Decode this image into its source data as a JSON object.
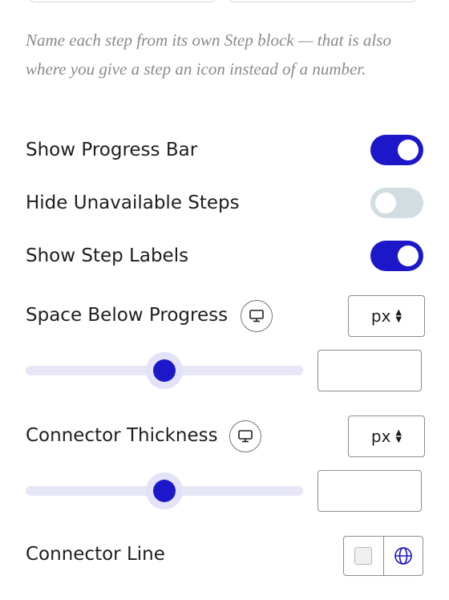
{
  "help_text": "Name each step from its own Step block — that is also where you give a step an icon instead of a number.",
  "toggles": {
    "show_progress_bar": {
      "label": "Show Progress Bar",
      "checked": true
    },
    "hide_unavailable_steps": {
      "label": "Hide Unavailable Steps",
      "checked": false
    },
    "show_step_labels": {
      "label": "Show Step Labels",
      "checked": true
    }
  },
  "space_below_progress": {
    "label": "Space Below Progress",
    "device_icon": "desktop-icon",
    "unit": "px",
    "slider_fraction": 0.5,
    "value": ""
  },
  "connector_thickness": {
    "label": "Connector Thickness",
    "device_icon": "desktop-icon",
    "unit": "px",
    "slider_fraction": 0.5,
    "value": ""
  },
  "connector_line": {
    "label": "Connector Line",
    "color_icon": "color-swatch-icon",
    "global_icon": "globe-icon"
  },
  "colors": {
    "accent": "#1c17c9",
    "toggle_off": "#d1dde1",
    "help_text": "#8a8a8a"
  }
}
